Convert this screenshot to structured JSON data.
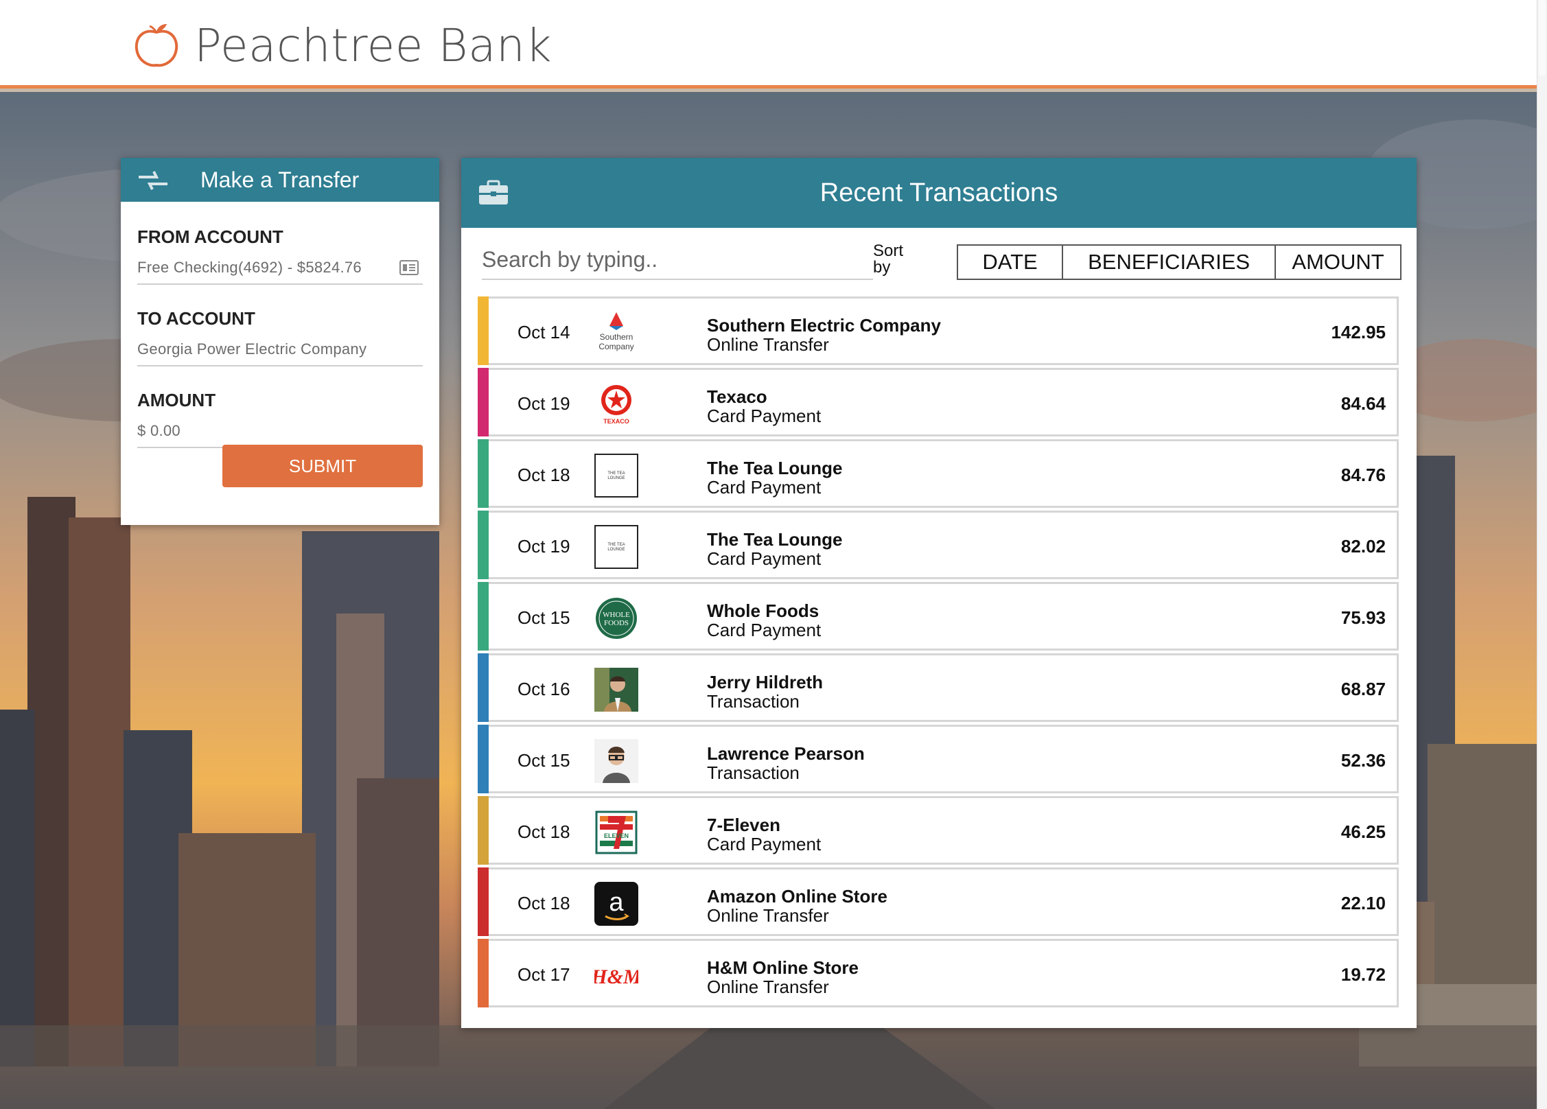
{
  "header": {
    "brand": "Peachtree Bank"
  },
  "transfer": {
    "title": "Make a Transfer",
    "from_label": "FROM ACCOUNT",
    "from_value": "Free Checking(4692) - $5824.76",
    "to_label": "TO ACCOUNT",
    "to_value": "Georgia Power Electric Company",
    "amount_label": "AMOUNT",
    "amount_placeholder": "$ 0.00",
    "submit_label": "SUBMIT"
  },
  "transactions": {
    "title": "Recent Transactions",
    "search_placeholder": "Search by typing..",
    "sort_label_1": "Sort",
    "sort_label_2": "by",
    "sort_options": [
      "DATE",
      "BENEFICIARIES",
      "AMOUNT"
    ],
    "rows": [
      {
        "date": "Oct 14",
        "name": "Southern Electric Company",
        "kind": "Online Transfer",
        "amount": "142.95",
        "color": "#f2b635",
        "logo": "southern-company-logo"
      },
      {
        "date": "Oct 19",
        "name": "Texaco",
        "kind": "Card Payment",
        "amount": "84.64",
        "color": "#d22a6f",
        "logo": "texaco-logo"
      },
      {
        "date": "Oct 18",
        "name": "The Tea Lounge",
        "kind": "Card Payment",
        "amount": "84.76",
        "color": "#3aa87e",
        "logo": "tea-lounge-logo"
      },
      {
        "date": "Oct 19",
        "name": "The Tea Lounge",
        "kind": "Card Payment",
        "amount": "82.02",
        "color": "#3aa87e",
        "logo": "tea-lounge-logo"
      },
      {
        "date": "Oct 15",
        "name": "Whole Foods",
        "kind": "Card Payment",
        "amount": "75.93",
        "color": "#3aa87e",
        "logo": "whole-foods-logo"
      },
      {
        "date": "Oct 16",
        "name": "Jerry Hildreth",
        "kind": "Transaction",
        "amount": "68.87",
        "color": "#2f80b8",
        "logo": "jerry-hildreth-avatar"
      },
      {
        "date": "Oct 15",
        "name": "Lawrence Pearson",
        "kind": "Transaction",
        "amount": "52.36",
        "color": "#2f80b8",
        "logo": "lawrence-pearson-avatar"
      },
      {
        "date": "Oct 18",
        "name": "7-Eleven",
        "kind": "Card Payment",
        "amount": "46.25",
        "color": "#d4a33a",
        "logo": "seven-eleven-logo"
      },
      {
        "date": "Oct 18",
        "name": "Amazon Online Store",
        "kind": "Online Transfer",
        "amount": "22.10",
        "color": "#cc2d2d",
        "logo": "amazon-logo"
      },
      {
        "date": "Oct 17",
        "name": "H&M Online Store",
        "kind": "Online Transfer",
        "amount": "19.72",
        "color": "#e2693a",
        "logo": "hm-logo"
      }
    ],
    "logo_texts": {
      "southern": [
        "Southern",
        "Company"
      ],
      "texaco": "TEXACO",
      "tea": [
        "THE TEA",
        "LOUNGE"
      ],
      "wholefoods": [
        "WHOLE",
        "FOODS"
      ],
      "seven": "ELEVEN",
      "amazon": "a",
      "hm": "H&M"
    }
  },
  "colors": {
    "accent": "#2f7e92",
    "submit": "#e0703f",
    "header_rule": "#e9854a"
  }
}
